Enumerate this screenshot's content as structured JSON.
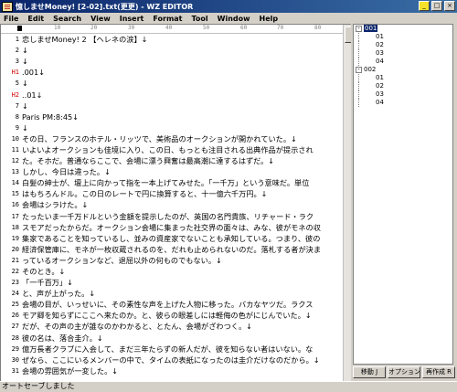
{
  "window": {
    "title": "憶しませMoney! [2-02].txt(更更) - WZ EDITOR",
    "buttons": [
      "_",
      "□",
      "×"
    ]
  },
  "menu": [
    "File",
    "Edit",
    "Search",
    "View",
    "Insert",
    "Format",
    "Tool",
    "Window",
    "Help"
  ],
  "ruler": [
    "10",
    "20",
    "30",
    "40",
    "50",
    "60",
    "70",
    "80"
  ],
  "lines": [
    {
      "n": "1",
      "text": "恋しませMoney! 2 【ヘレネの涙】↓"
    },
    {
      "n": "2",
      "text": "↓"
    },
    {
      "n": "3",
      "text": "↓"
    },
    {
      "n": "H1",
      "text": ".001↓",
      "heading": true
    },
    {
      "n": "5",
      "text": "↓"
    },
    {
      "n": "H2",
      "text": "..01↓",
      "heading": true
    },
    {
      "n": "7",
      "text": "↓"
    },
    {
      "n": "8",
      "text": "  Paris  PM:8:45↓"
    },
    {
      "n": "9",
      "text": "↓"
    },
    {
      "n": "10",
      "text": "  その日、フランスのホテル・リッツで、美術品のオークションが開かれていた。↓"
    },
    {
      "n": "11",
      "text": "  いよいよオークションも佳境に入り、この日、もっとも注目される出典作品が提示され"
    },
    {
      "n": "12",
      "text": "た。そホだ。普通ならここで、会場に漂う興奮は最高潮に達するはずだ。↓"
    },
    {
      "n": "13",
      "text": "  しかし、今日は違った。↓"
    },
    {
      "n": "14",
      "text": "  白髪の紳士が、壇上に向かって指を一本上げてみせた。「一千万」という意味だ。単位"
    },
    {
      "n": "15",
      "text": "はもちろんドル。この日のレートで円に換算すると、十一億六千万円。↓"
    },
    {
      "n": "16",
      "text": "  会場はシラけた。↓"
    },
    {
      "n": "17",
      "text": "  たったいま一千万ドルという金額を提示したのが、英国の名門貴族、リチャード・ラク"
    },
    {
      "n": "18",
      "text": "スモアだったからだ。オークション会場に集まった社交界の面々は、みな、彼がモネの収"
    },
    {
      "n": "19",
      "text": "集家であることを知っているし、並みの資産家でないことも承知している。つまり、彼の"
    },
    {
      "n": "20",
      "text": "経済保管庫に、モネが一枚収蔵されるのを、だれも止められないのだ。落札する者が決ま"
    },
    {
      "n": "21",
      "text": "っているオークションなど、退屈以外の何ものでもない。↓"
    },
    {
      "n": "22",
      "text": "  そのとき。↓"
    },
    {
      "n": "23",
      "text": "「一千百万」↓"
    },
    {
      "n": "24",
      "text": "  と、声が上がった。↓"
    },
    {
      "n": "25",
      "text": "  会場の目が、いっせいに、その素性な声を上げた人物に移った。バカなヤツだ。ラクス"
    },
    {
      "n": "26",
      "text": "モア卿を知らずにここへ来たのか。と、彼らの眼差しには軽侮の色がにじんでいた。↓"
    },
    {
      "n": "27",
      "text": "  だが、その声の主が誰なのかわかると、とたん、会場がざわつく。↓"
    },
    {
      "n": "28",
      "text": "  彼の名は、落合圭介。↓"
    },
    {
      "n": "29",
      "text": "  億万長者クラブに入会して、まだ三年たらずの新人だが、彼を知らない者はいない。な"
    },
    {
      "n": "30",
      "text": "ぜなら、ここにいるメンバーの中で、タイムの表紙になったのは圭介だけなのだから。↓"
    },
    {
      "n": "31",
      "text": "  会場の雰囲気が一変した。↓"
    }
  ],
  "outline": {
    "groups": [
      {
        "label": "001",
        "selected": true,
        "children": [
          "01",
          "02",
          "03",
          "04"
        ]
      },
      {
        "label": "002",
        "selected": false,
        "children": [
          "01",
          "02",
          "03",
          "04"
        ]
      }
    ]
  },
  "panel_buttons": [
    "移動 J",
    "オプション M",
    "再作成 R"
  ],
  "status": "オートセーブしました"
}
